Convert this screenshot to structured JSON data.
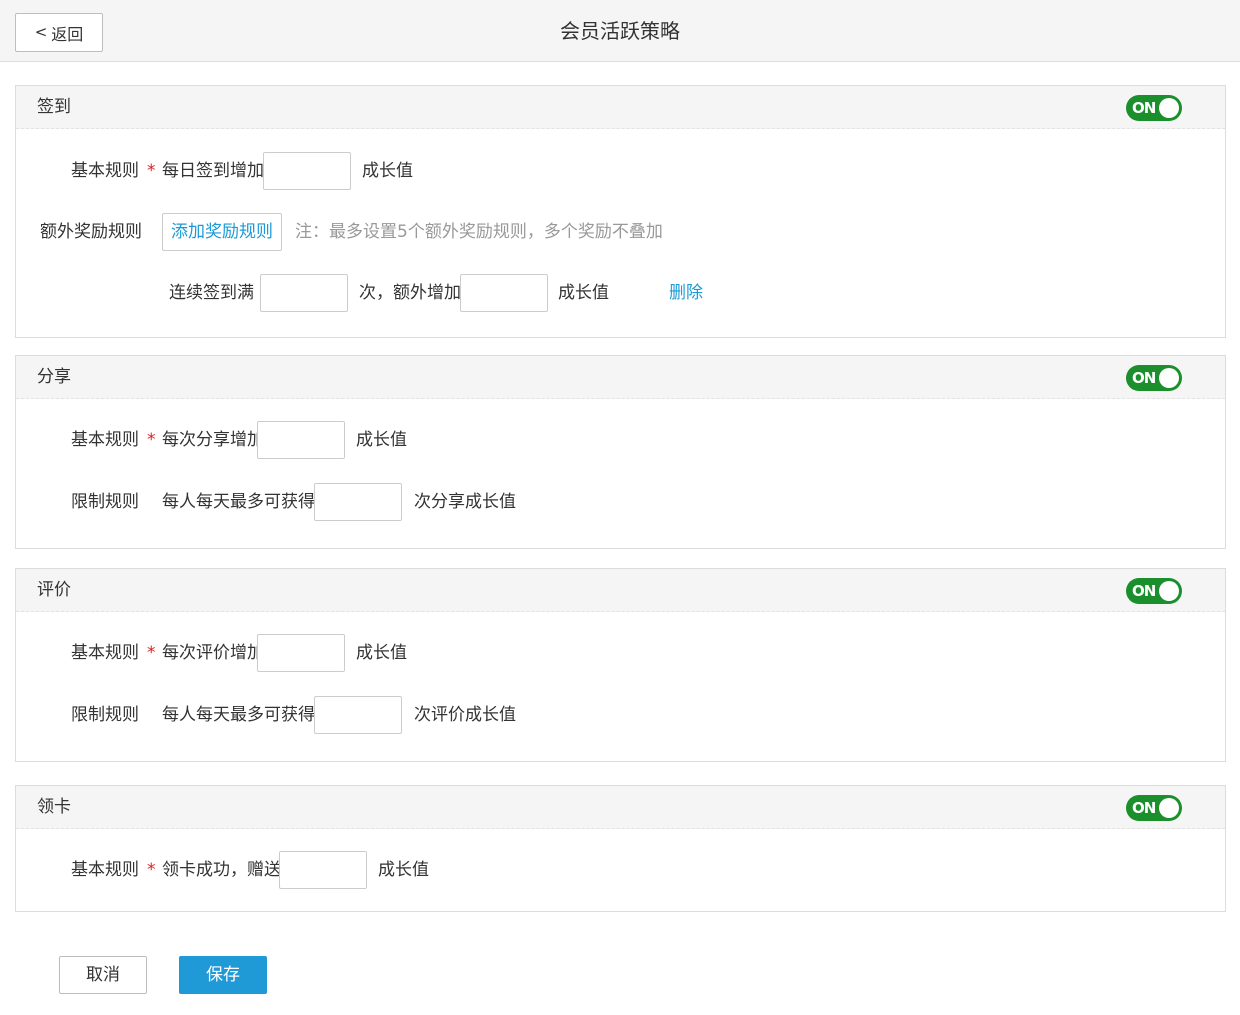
{
  "header": {
    "back_label": "返回",
    "title": "会员活跃策略"
  },
  "toggle_label": "ON",
  "sections": {
    "sign_in": {
      "title": "签到",
      "basic_rule_label": "基本规则",
      "basic_rule_prefix": "每日签到增加",
      "unit": "成长值",
      "extra_rule_label": "额外奖励规则",
      "add_rule_button": "添加奖励规则",
      "extra_note": "注：最多设置5个额外奖励规则，多个奖励不叠加",
      "streak_prefix": "连续签到满",
      "streak_mid": "次，额外增加",
      "delete_label": "删除"
    },
    "share": {
      "title": "分享",
      "basic_rule_label": "基本规则",
      "basic_rule_prefix": "每次分享增加",
      "unit": "成长值",
      "limit_label": "限制规则",
      "limit_prefix": "每人每天最多可获得",
      "limit_suffix": "次分享成长值"
    },
    "review": {
      "title": "评价",
      "basic_rule_label": "基本规则",
      "basic_rule_prefix": "每次评价增加",
      "unit": "成长值",
      "limit_label": "限制规则",
      "limit_prefix": "每人每天最多可获得",
      "limit_suffix": "次评价成长值"
    },
    "card": {
      "title": "领卡",
      "basic_rule_label": "基本规则",
      "basic_rule_prefix": "领卡成功，赠送",
      "unit": "成长值"
    }
  },
  "required_mark": "*",
  "footer": {
    "cancel_label": "取消",
    "save_label": "保存"
  },
  "colors": {
    "toggle_on": "#1a8f2c",
    "link": "#1a9bd7",
    "primary": "#1f9ad6",
    "required": "#e0201e"
  }
}
